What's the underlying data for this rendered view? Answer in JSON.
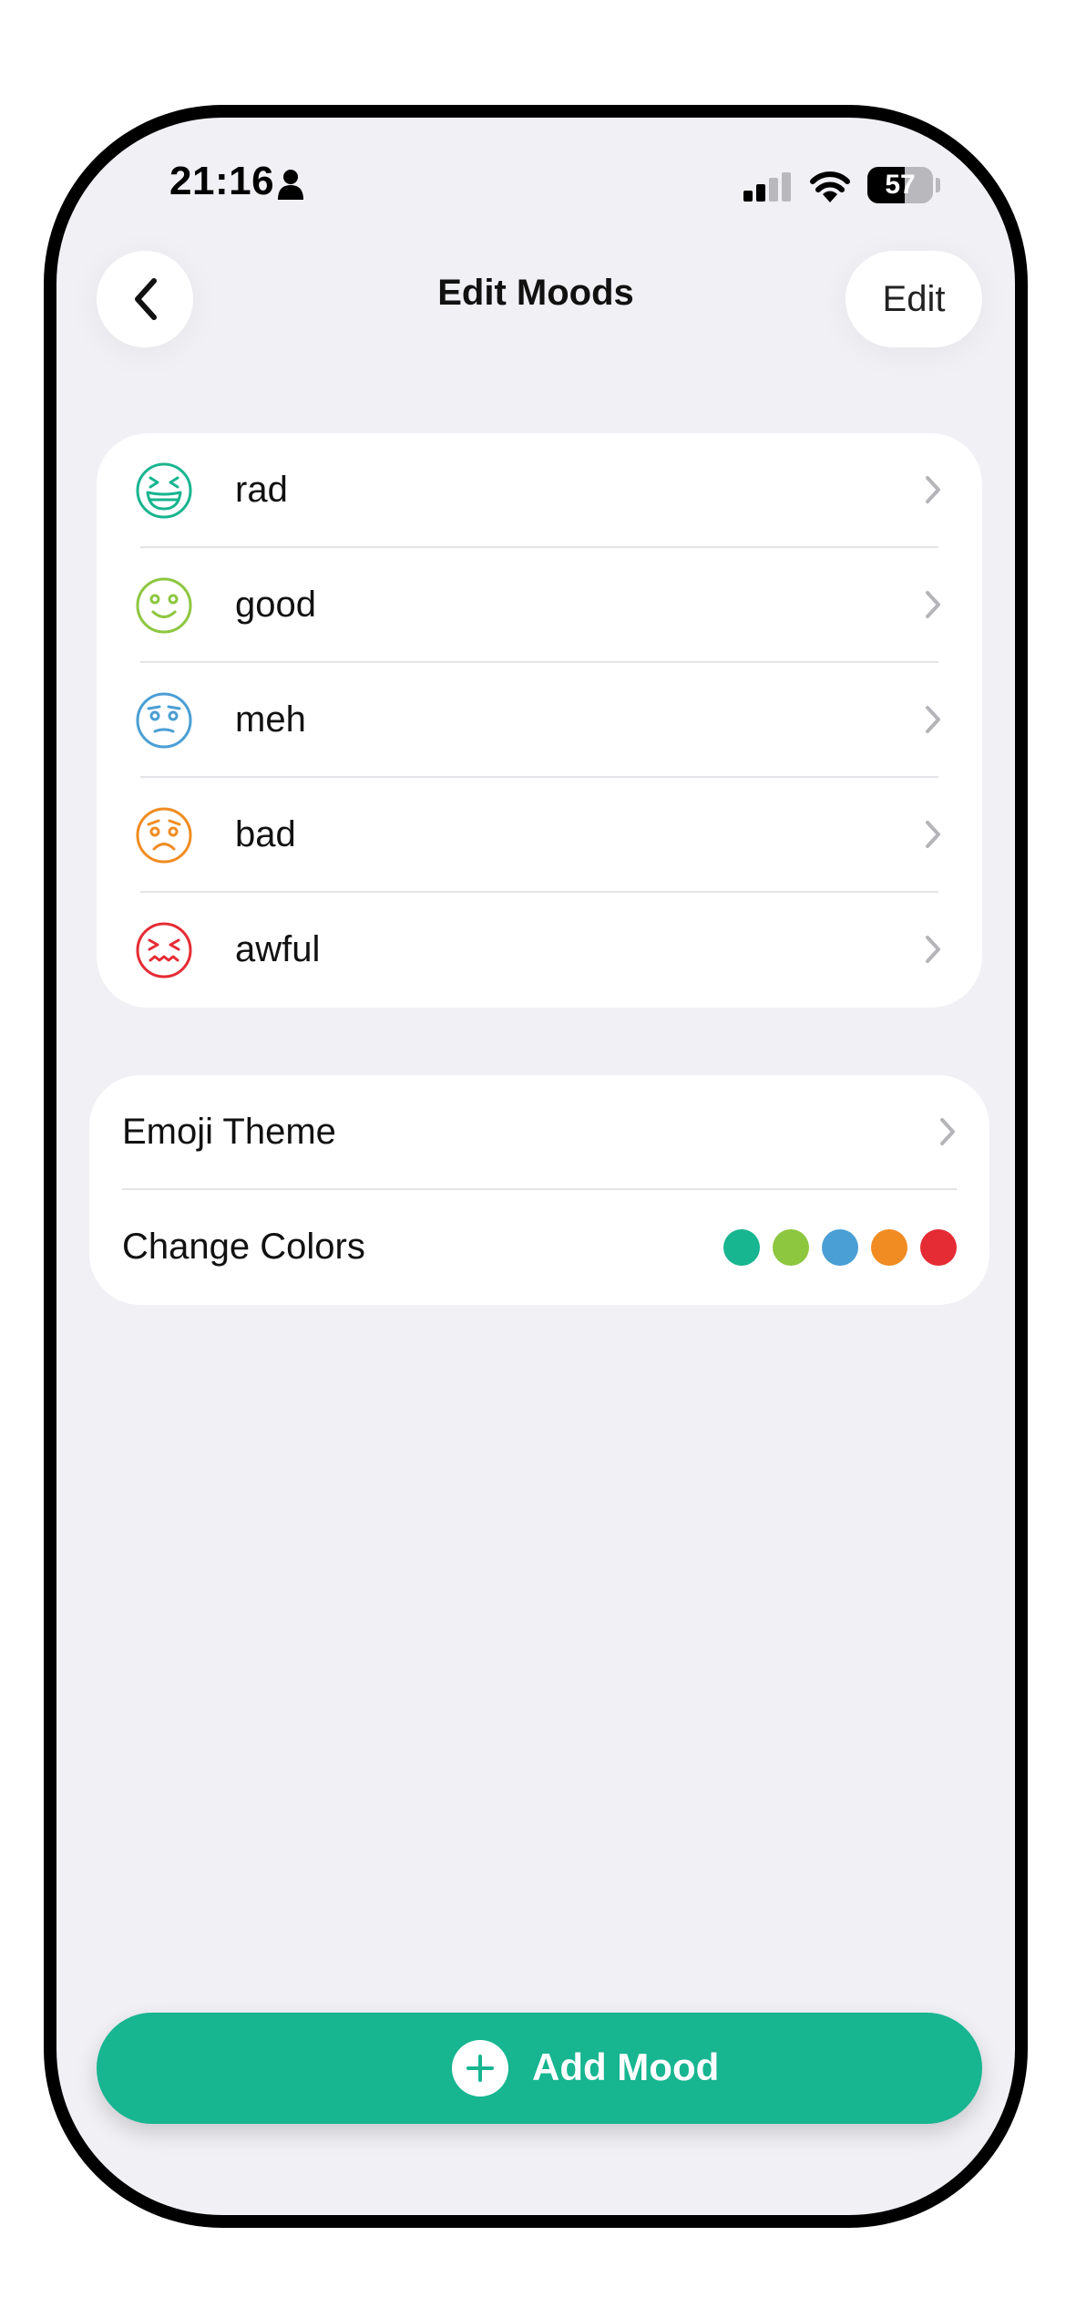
{
  "status_bar": {
    "time": "21:16",
    "battery_level": "57",
    "battery_fraction": 0.57,
    "icons": [
      "person-icon",
      "cellular-signal-icon",
      "wifi-icon",
      "battery-icon"
    ]
  },
  "nav": {
    "back_icon": "chevron-left-icon",
    "title": "Edit Moods",
    "edit_label": "Edit"
  },
  "moods": [
    {
      "label": "rad",
      "icon": "grinning-squint-face-icon",
      "color": "#17b590"
    },
    {
      "label": "good",
      "icon": "smiling-face-icon",
      "color": "#8dc63f"
    },
    {
      "label": "meh",
      "icon": "skeptical-face-icon",
      "color": "#4a9fd4"
    },
    {
      "label": "bad",
      "icon": "sad-face-icon",
      "color": "#f08c22"
    },
    {
      "label": "awful",
      "icon": "distressed-face-icon",
      "color": "#e52b34"
    }
  ],
  "settings": {
    "emoji_theme_label": "Emoji Theme",
    "change_colors_label": "Change Colors",
    "colors": [
      "#17b590",
      "#8dc63f",
      "#4a9fd4",
      "#f08c22",
      "#e52b34"
    ]
  },
  "add_button": {
    "label": "Add Mood",
    "icon": "plus-icon",
    "color": "#17b590"
  }
}
